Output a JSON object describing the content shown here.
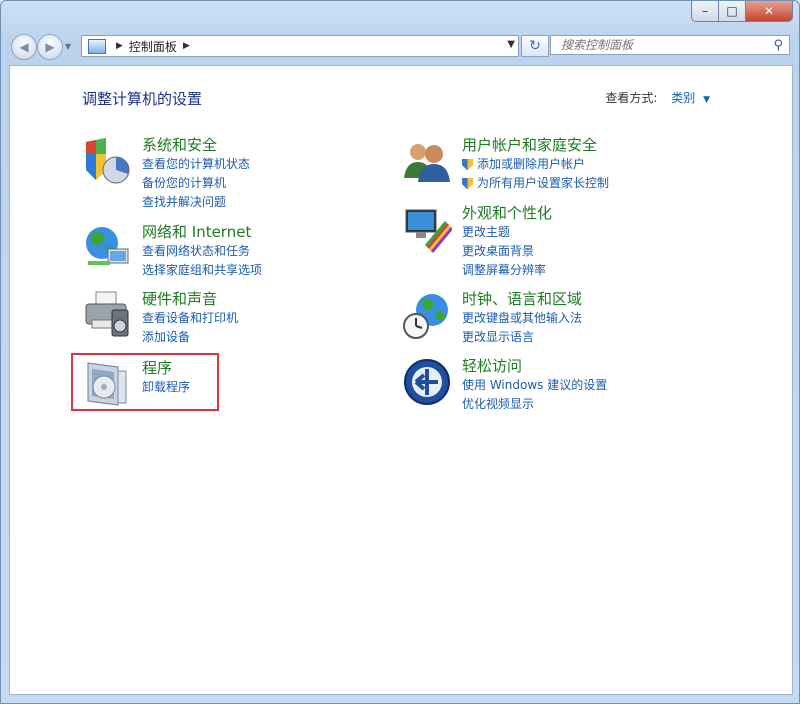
{
  "window": {
    "caption_buttons": {
      "minimize": "–",
      "maximize": "□",
      "close": "✕"
    }
  },
  "navbar": {
    "back_glyph": "◀",
    "forward_glyph": "▶",
    "address_path": "控制面板",
    "search_placeholder": "搜索控制面板"
  },
  "page": {
    "heading": "调整计算机的设置",
    "view_by_label": "查看方式:",
    "view_by_value": "类别"
  },
  "categories": [
    {
      "title": "系统和安全",
      "icon": "system-security-icon",
      "links": [
        "查看您的计算机状态",
        "备份您的计算机",
        "查找并解决问题"
      ]
    },
    {
      "title": "网络和 Internet",
      "icon": "network-internet-icon",
      "links": [
        "查看网络状态和任务",
        "选择家庭组和共享选项"
      ]
    },
    {
      "title": "硬件和声音",
      "icon": "hardware-sound-icon",
      "links": [
        "查看设备和打印机",
        "添加设备"
      ]
    },
    {
      "title": "程序",
      "icon": "programs-icon",
      "links": [
        "卸载程序"
      ]
    },
    {
      "title": "用户帐户和家庭安全",
      "icon": "user-accounts-icon",
      "links": [
        "添加或删除用户帐户",
        "为所有用户设置家长控制"
      ]
    },
    {
      "title": "外观和个性化",
      "icon": "appearance-icon",
      "links": [
        "更改主题",
        "更改桌面背景",
        "调整屏幕分辨率"
      ]
    },
    {
      "title": "时钟、语言和区域",
      "icon": "clock-language-region-icon",
      "links": [
        "更改键盘或其他输入法",
        "更改显示语言"
      ]
    },
    {
      "title": "轻松访问",
      "icon": "ease-of-access-icon",
      "links": [
        "使用 Windows 建议的设置",
        "优化视频显示"
      ]
    }
  ],
  "colors": {
    "highlight": "#e0323a",
    "category_title": "#1f7b23",
    "link": "#1b5caf",
    "heading": "#1e3287"
  }
}
